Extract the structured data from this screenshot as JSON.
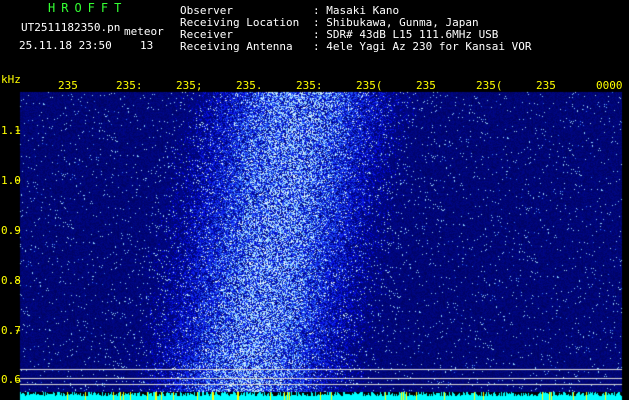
{
  "header": {
    "brand": "HROFFT",
    "filename": "UT2511182350.pn",
    "tag": "meteor",
    "datetime": "25.11.18 23:50",
    "count": "13",
    "info_labels": [
      "Observer",
      "Receiving Location",
      "Receiver",
      "Receiving Antenna"
    ],
    "info_values": [
      ": Masaki Kano",
      ": Shibukawa, Gunma, Japan",
      ": SDR# 43dB L15 111.6MHz USB",
      ": 4ele Yagi Az 230 for Kansai VOR"
    ]
  },
  "time_axis": {
    "ticks": [
      "235",
      "235:",
      "235;",
      "235.",
      "235:",
      "235(",
      "235",
      "235(",
      "235",
      "0000"
    ]
  },
  "freq_axis": {
    "unit": "kHz",
    "ticks": [
      "1.1",
      "1.0",
      "0.9",
      "0.8",
      "0.7",
      "0.6"
    ]
  },
  "colors": {
    "background": "#000000",
    "noise_base": "#000a6e",
    "signal_hot": "#a0e6ff",
    "bottom_band": "#00ffff",
    "markers": "#ffff00",
    "ref_lines": "#d8d8d8"
  }
}
